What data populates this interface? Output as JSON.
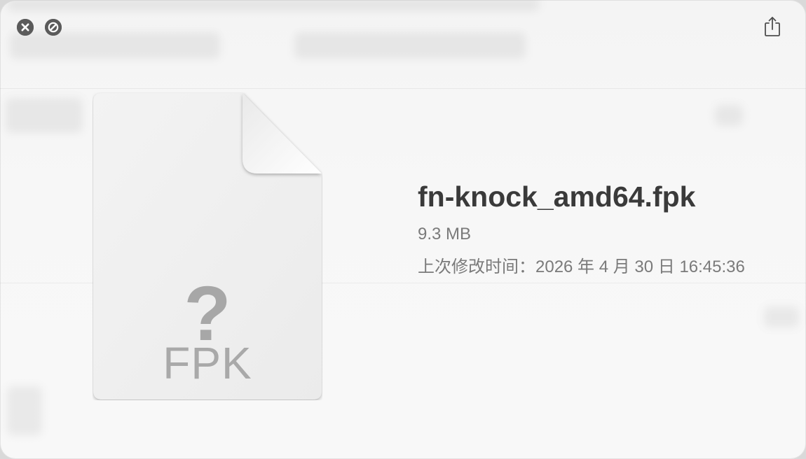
{
  "window": {
    "close_icon": "close-icon",
    "disable_icon": "no-entry-icon",
    "share_icon": "share-icon"
  },
  "file": {
    "icon_glyph": "?",
    "extension_label": "FPK",
    "name": "fn-knock_amd64.fpk",
    "size": "9.3 MB",
    "modified": "上次修改时间：2026 年 4 月 30 日 16:45:36"
  },
  "colors": {
    "title_text": "#3a3a3a",
    "meta_text": "#7a7a7a",
    "icon_gray": "#a7a7a7"
  }
}
